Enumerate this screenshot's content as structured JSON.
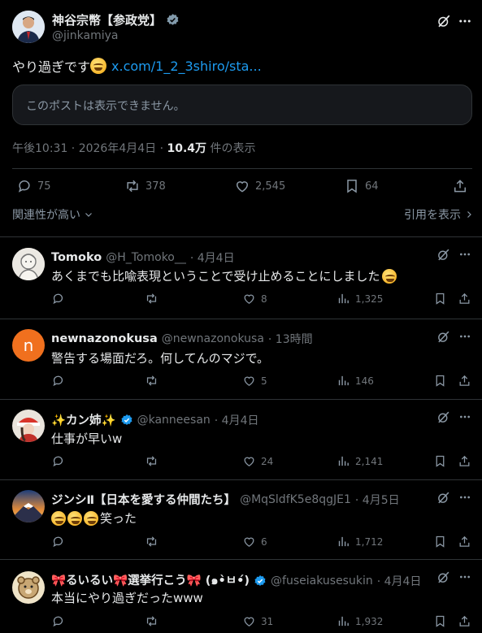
{
  "post": {
    "author_name": "神谷宗幣【参政党】",
    "author_handle": "@jinkamiya",
    "text": "やり過ぎです",
    "link": "x.com/1_2_3shiro/sta...",
    "quoted_unavailable": "このポストは表示できません。",
    "timestamp": "午後10:31 · 2026年4月4日 · ",
    "views": "10.4万",
    "views_suffix": " 件の表示",
    "replies": "75",
    "reposts": "378",
    "likes": "2,545",
    "bookmarks": "64"
  },
  "sort": {
    "left_label": "関連性が高い",
    "right_label": "引用を表示"
  },
  "replies": [
    {
      "name": "Tomoko",
      "handle": "@H_Tomoko__",
      "date": "· 4月4日",
      "text": "あくまでも比喩表現ということで受け止めることにしました",
      "likes": "8",
      "views": "1,325",
      "avatar_color": "#e9e6e0"
    },
    {
      "name": "newnazonokusa",
      "handle": "@newnazonokusa",
      "date": "· 13時間",
      "text": "警告する場面だろ。何してんのマジで。",
      "likes": "5",
      "views": "146",
      "avatar_letter": "n",
      "avatar_color": "#f0701e"
    },
    {
      "name": "✨カン姉✨",
      "handle": "@kanneesan",
      "date": "· 4月4日",
      "text": "仕事が早いw",
      "likes": "24",
      "views": "2,141",
      "avatar_color": "#c94a3a"
    },
    {
      "name": "ジンシⅡ【日本を愛する仲間たち】",
      "handle": "@MqSldfK5e8qgJE1",
      "date": "· 4月5日",
      "text": "笑った",
      "likes": "6",
      "views": "1,712",
      "avatar_color": "#2a4f8a"
    },
    {
      "name": "🎀るいるい🎀選挙行こう🎀 (๑•̀ㅂ•́)",
      "handle": "@fuseiakusesukin",
      "date": "· 4月4日",
      "text": "本当にやり過ぎだったwww",
      "likes": "31",
      "views": "1,932",
      "avatar_color": "#d9c9a8"
    }
  ]
}
